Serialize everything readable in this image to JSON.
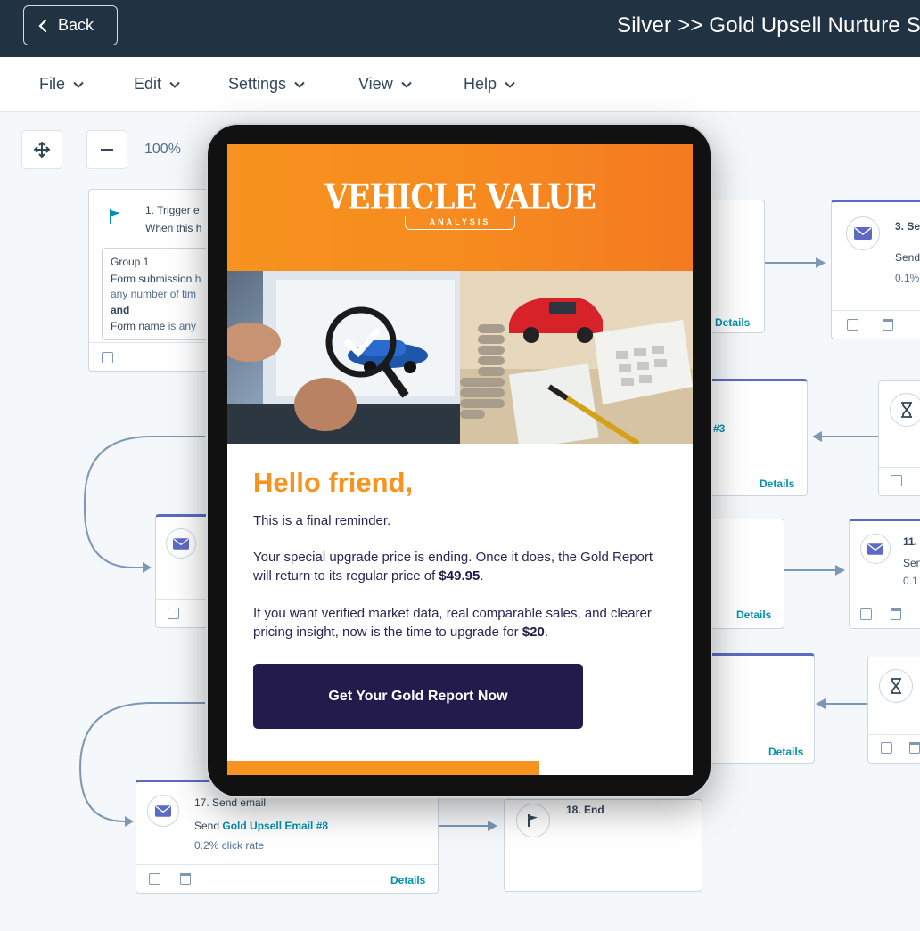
{
  "header": {
    "back_label": "Back",
    "workflow_title": "Silver >> Gold Upsell Nurture S"
  },
  "menu": [
    {
      "label": "File"
    },
    {
      "label": "Edit"
    },
    {
      "label": "Settings"
    },
    {
      "label": "View"
    },
    {
      "label": "Help"
    }
  ],
  "canvas": {
    "zoom": "100%",
    "trigger": {
      "title": "1. Trigger e",
      "subtitle": "When this h",
      "group_label": "Group 1",
      "line1_strong": "Form submission",
      "line1_rest": " h",
      "line2": "any number of tim",
      "conj": "and",
      "line3_strong": "Form name",
      "line3_rest": " is any"
    },
    "node3": {
      "title": "3. Se",
      "line1": "Send",
      "line2": "0.1%"
    },
    "node_partial_3": {
      "text": "#3"
    },
    "node11": {
      "title": "11. S",
      "line1": "Sen",
      "line2": "0.1"
    },
    "node17": {
      "title": "17. Send email",
      "send_prefix": "Send ",
      "email_link": "Gold Upsell Email #8",
      "click_rate": "0.2% click rate"
    },
    "node18": {
      "title": "18. End"
    },
    "details_label": "Details"
  },
  "email": {
    "brand_main": "VEHICLE VALUE",
    "brand_sub": "ANALYSIS",
    "greeting": "Hello friend,",
    "reminder": "This is a final reminder.",
    "para1_text": "Your special upgrade price is ending. Once it does, the Gold Report will return to its regular price of ",
    "para1_price": "$49.95",
    "para1_end": ".",
    "para2_text": "If you want verified market data, real comparable sales, and clearer pricing insight, now is the time to upgrade for ",
    "para2_price": "$20",
    "para2_end": ".",
    "cta_label": "Get Your Gold Report Now"
  },
  "colors": {
    "header_bg": "#213343",
    "accent_orange": "#f7931e",
    "cta_bg": "#221b4c",
    "link": "#0091ae"
  }
}
